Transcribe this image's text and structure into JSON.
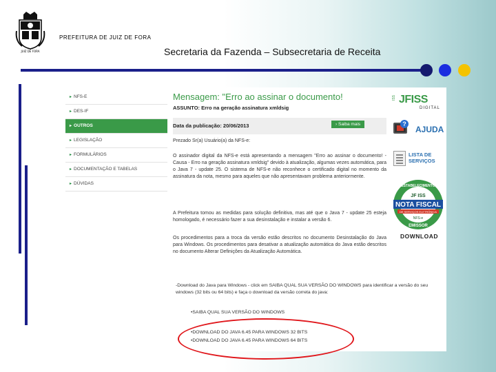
{
  "slide": {
    "org": "PREFEITURA DE JUIZ DE FORA",
    "crest_caption": "JUIZ DE FORA",
    "title": "Secretaria da Fazenda – Subsecretaria de Receita",
    "accent_colors": [
      "#141a6e",
      "#1b2de0",
      "#f4c300"
    ]
  },
  "screenshot": {
    "nav": [
      {
        "label": "NFS-E",
        "active": false
      },
      {
        "label": "DES-IF",
        "active": false
      },
      {
        "label": "OUTROS",
        "active": true
      },
      {
        "label": "LEGISLAÇÃO",
        "active": false
      },
      {
        "label": "FORMULÁRIOS",
        "active": false
      },
      {
        "label": "DOCUMENTAÇÃO E TABELAS",
        "active": false
      },
      {
        "label": "DÚVIDAS",
        "active": false
      }
    ],
    "message": {
      "title": "Mensagem: \"Erro ao assinar o documento!",
      "subject": "ASSUNTO: Erro na geração assinatura xmldsig",
      "pub_date": "Data da publicação: 20/06/2013",
      "saiba_button": "Saiba mais",
      "greeting": "Prezado Sr(a) Usuário(a) da NFS-e:",
      "p1": "O assinador digital da NFS-e está apresentando a mensagem \"Erro ao assinar o documento! - Causa - Erro na geração assinatura xmldsig\" devido à atualização, algumas vezes automática, para o Java 7 - update 25. O sistema de NFS-e não reconhece o certificado digital no momento da assinatura da nota, mesmo para aqueles que não apresentavam problema anteriormente.",
      "p2": "A Prefeitura tomou as medidas para solução definitiva, mas até que o Java 7 - update 25 esteja homologado, é necessário fazer a sua desinstalação e instalar a versão 6.",
      "p3": "Os procedimentos para a troca da versão estão descritos no documento Desinstalação do Java para Windows. Os procedimentos para desativar a atualização automática do Java estão descritos no documento Alterar Definições da Atualização Automática.",
      "download_note": "-Download do Java para Windows - click em SAIBA QUAL SUA VERSÃO DO WINDOWS para identificar a versão do seu windows (32 bits ou 64 bits) e faça o download da versão correta do java:",
      "link_saiba": "•SAIBA QUAL SUA VERSÃO DO WINDOWS",
      "link_32": "•DOWNLOAD DO JAVA 6.45 PARA WINDOWS 32 BITS",
      "link_64": "•DOWNLOAD DO JAVA 6.45 PARA WINDOWS 64 BITS"
    },
    "right": {
      "fiss_vertical": "ISS",
      "fiss_logo": "JFISS",
      "fiss_sub": "DIGITAL",
      "ajuda": "AJUDA",
      "servicos": "LISTA DE SERVIÇOS",
      "badge_top": "ESTABELECIMENTO",
      "badge_iss": "JF ISS",
      "badge_main": "NOTA FISCAL",
      "badge_sub": "DE SERVIÇOS ELETRÔNICA",
      "badge_nfse": "NFS-e",
      "badge_bottom": "EMISSOR",
      "download": "DOWNLOAD"
    }
  }
}
